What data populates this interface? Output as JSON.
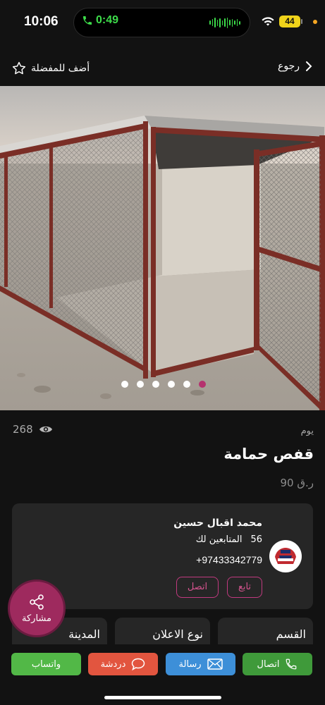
{
  "status_bar": {
    "time": "10:06",
    "call_timer": "0:49",
    "battery": "44"
  },
  "nav": {
    "add_favorite": "أضف للمفضلة",
    "back": "رجوع"
  },
  "gallery": {
    "image_count": 6,
    "active_index": 5
  },
  "listing": {
    "views": "268",
    "day": "يوم",
    "title": "قفص حمامة",
    "price": "90 ر.ق"
  },
  "seller": {
    "name": "محمد اقبال حسين",
    "followers_label": "المتابعين لك",
    "followers_count": "56",
    "phone": "+97433342779",
    "follow_button": "تابع",
    "contact_button": "اتصل"
  },
  "details": {
    "category_label": "القسم",
    "ad_type_label": "نوع الاعلان",
    "city_label": "المدينة"
  },
  "share": {
    "label": "مشاركة"
  },
  "actions": {
    "call": "اتصال",
    "message": "رسالة",
    "chat": "دردشة",
    "whatsapp": "واتساب"
  },
  "colors": {
    "background": "#121212",
    "card": "#262626",
    "accent_pink": "#b5316e",
    "call_green": "#3f9a3a",
    "message_blue": "#3d8fd8",
    "chat_red": "#e2553f",
    "whatsapp_green": "#52b847"
  }
}
